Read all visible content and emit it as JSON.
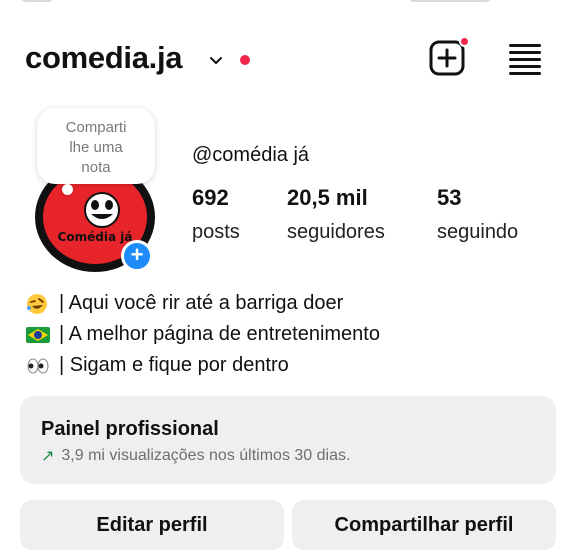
{
  "profile": {
    "username": "comedia.ja",
    "display_name": "@comédia já",
    "avatar_label": "Comédia já"
  },
  "note": {
    "lines": [
      "Comparti",
      "lhe uma",
      "nota"
    ]
  },
  "stats": {
    "posts": {
      "value": "692",
      "label": "posts"
    },
    "followers": {
      "value": "20,5 mil",
      "label": "seguidores"
    },
    "following": {
      "value": "53",
      "label": "seguindo"
    }
  },
  "bio": [
    {
      "emoji": "rofl-emoji",
      "text": "| Aqui você rir até a barriga doer"
    },
    {
      "emoji": "brazil-flag-emoji",
      "text": "| A melhor página de entretenimento"
    },
    {
      "emoji": "eyes-emoji",
      "text": "| Sigam e fique por dentro"
    }
  ],
  "professional_panel": {
    "title": "Painel profissional",
    "subtitle": "3,9 mi visualizações nos últimos 30 dias."
  },
  "buttons": {
    "edit": "Editar perfil",
    "share": "Compartilhar perfil"
  },
  "colors": {
    "notification_red": "#f0264a",
    "add_blue": "#1d8cf8",
    "trend_green": "#1a8a43",
    "panel_bg": "#efeff1"
  }
}
